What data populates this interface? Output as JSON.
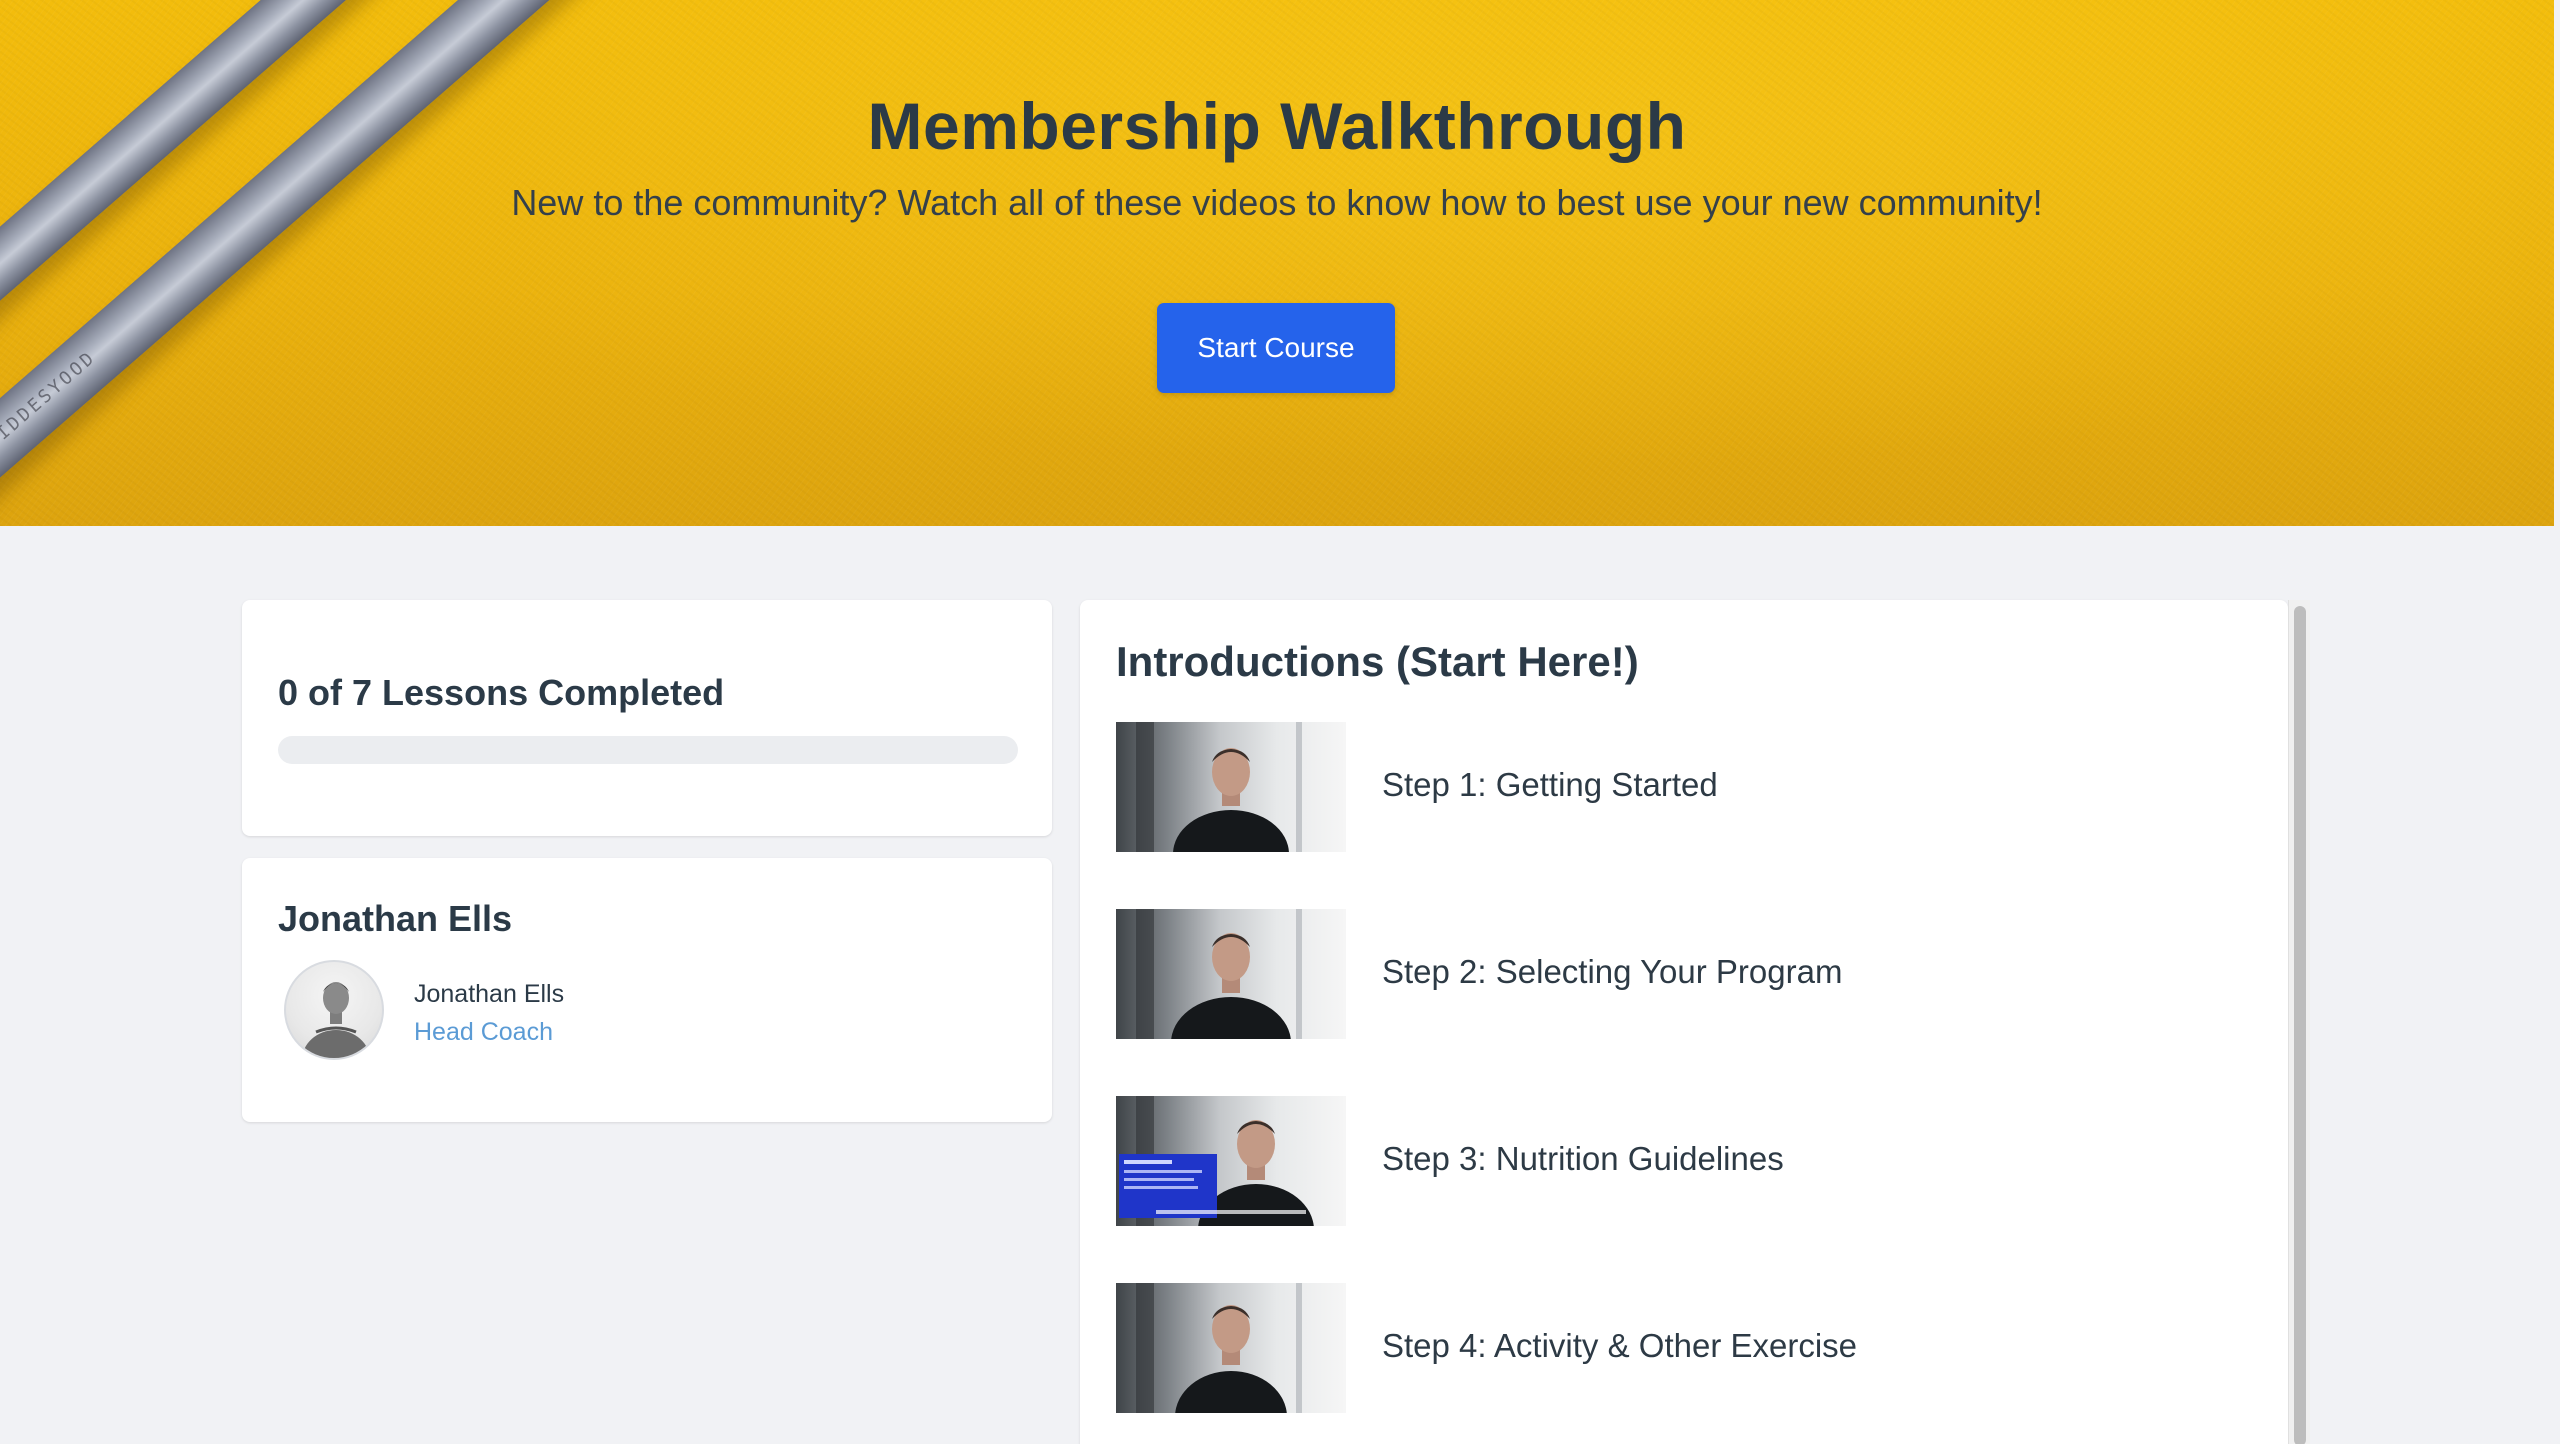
{
  "hero": {
    "title": "Membership Walkthrough",
    "subtitle": "New to the community? Watch all of these videos to know how to best use your new community!",
    "start_button": "Start Course",
    "pencil_text": "IDDESYOOD",
    "accent_color": "#2563eb",
    "background_color": "#f0b90c"
  },
  "progress": {
    "title": "0 of 7 Lessons Completed",
    "completed": 0,
    "total": 7
  },
  "instructor": {
    "heading": "Jonathan Ells",
    "name": "Jonathan Ells",
    "role": "Head Coach",
    "avatar_icon": "person-photo-icon"
  },
  "course": {
    "section_title": "Introductions (Start Here!)",
    "lessons": [
      {
        "title": "Step 1: Getting Started",
        "thumbnail": "video-thumbnail-icon"
      },
      {
        "title": "Step 2: Selecting Your Program",
        "thumbnail": "video-thumbnail-icon"
      },
      {
        "title": "Step 3: Nutrition Guidelines",
        "thumbnail": "video-thumbnail-icon"
      },
      {
        "title": "Step 4: Activity & Other Exercise",
        "thumbnail": "video-thumbnail-icon"
      }
    ]
  }
}
